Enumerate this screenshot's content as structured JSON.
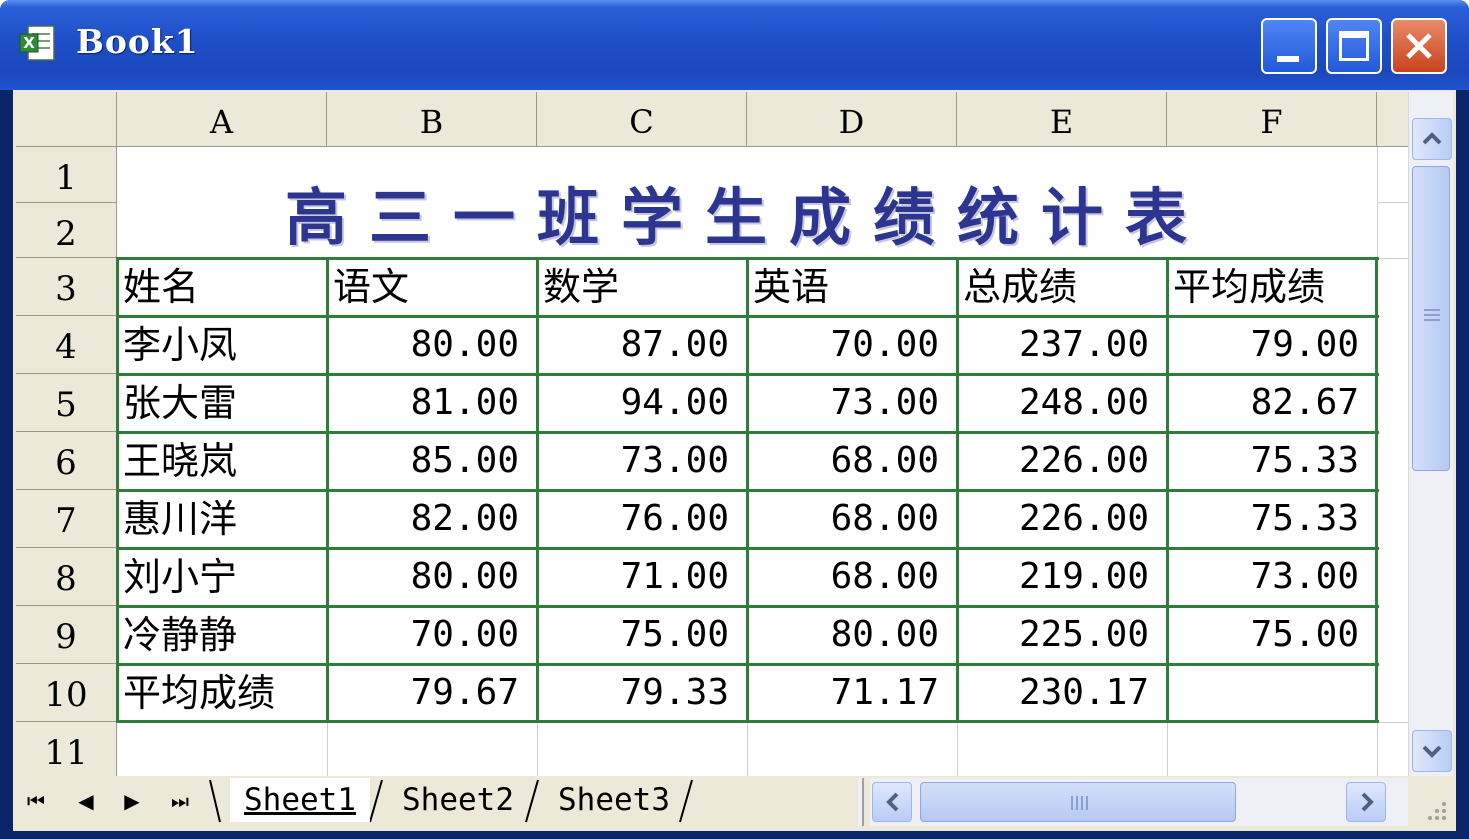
{
  "window": {
    "title": "Book1"
  },
  "columns": [
    "A",
    "B",
    "C",
    "D",
    "E",
    "F"
  ],
  "rows": [
    "1",
    "2",
    "3",
    "4",
    "5",
    "6",
    "7",
    "8",
    "9",
    "10",
    "11"
  ],
  "sheet_title": "高三一班学生成绩统计表",
  "table": {
    "headers": [
      "姓名",
      "语文",
      "数学",
      "英语",
      "总成绩",
      "平均成绩"
    ],
    "rows": [
      [
        "李小凤",
        "80.00",
        "87.00",
        "70.00",
        "237.00",
        "79.00"
      ],
      [
        "张大雷",
        "81.00",
        "94.00",
        "73.00",
        "248.00",
        "82.67"
      ],
      [
        "王晓岚",
        "85.00",
        "73.00",
        "68.00",
        "226.00",
        "75.33"
      ],
      [
        "惠川洋",
        "82.00",
        "76.00",
        "68.00",
        "226.00",
        "75.33"
      ],
      [
        "刘小宁",
        "80.00",
        "71.00",
        "68.00",
        "219.00",
        "73.00"
      ],
      [
        "冷静静",
        "70.00",
        "75.00",
        "80.00",
        "225.00",
        "75.00"
      ],
      [
        "平均成绩",
        "79.67",
        "79.33",
        "71.17",
        "230.17",
        ""
      ]
    ]
  },
  "tabs": [
    "Sheet1",
    "Sheet2",
    "Sheet3"
  ],
  "nav": {
    "first": "⏮",
    "prev": "◀",
    "next": "▶",
    "last": "⏭"
  },
  "colors": {
    "title_bar": "#1f4fc8",
    "border_green": "#2e7d3b",
    "title_text": "#2c3690"
  }
}
